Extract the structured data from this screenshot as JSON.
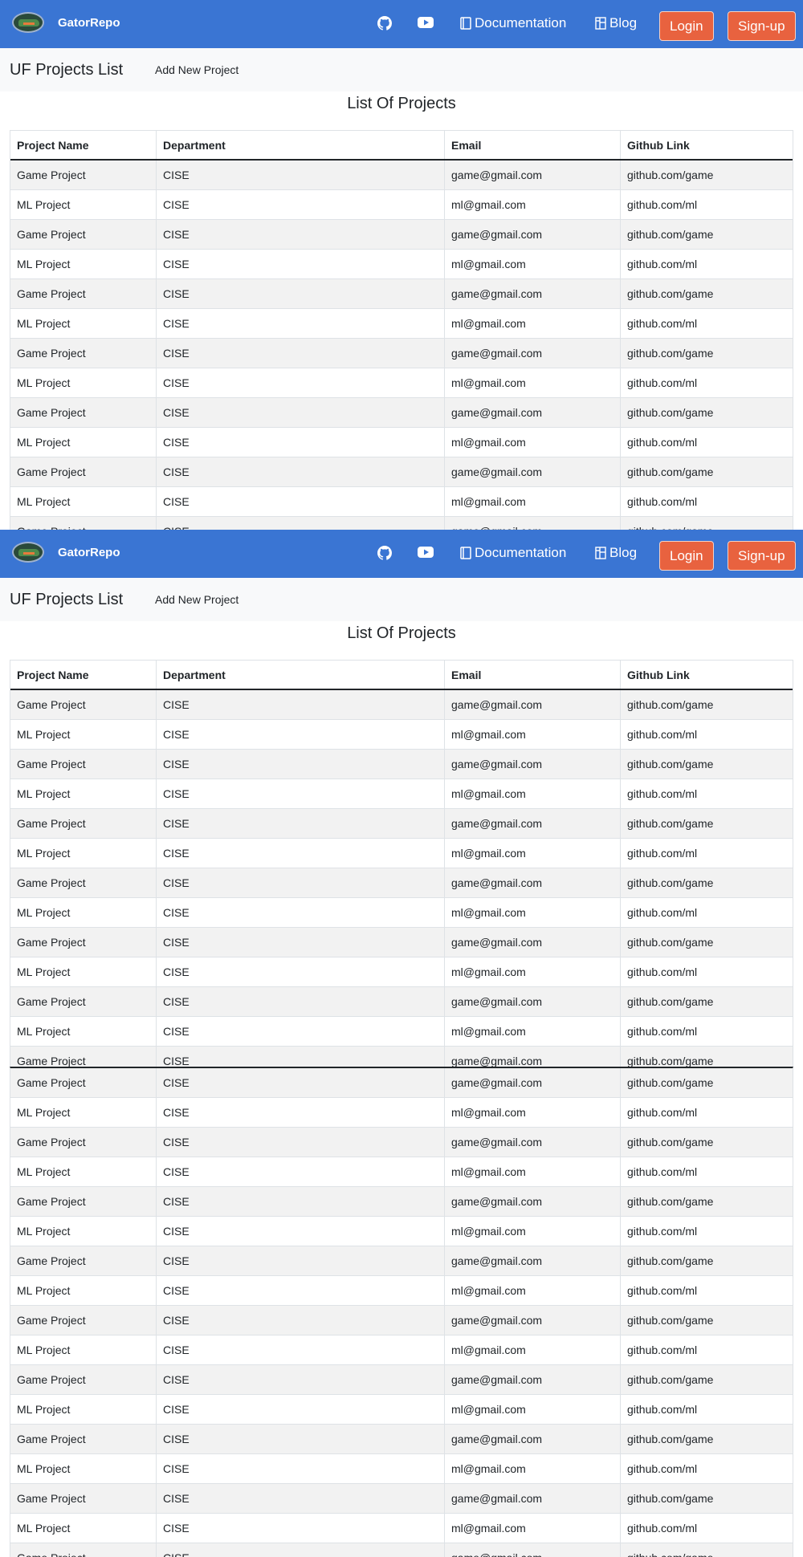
{
  "nav": {
    "brand": "GatorRepo",
    "documentation": "Documentation",
    "blog": "Blog",
    "login": "Login",
    "signup": "Sign-up",
    "icons": [
      "gator-logo-icon",
      "github-icon",
      "youtube-icon",
      "book-icon",
      "layout-icon"
    ]
  },
  "subbar": {
    "title": "UF Projects List",
    "add_project": "Add New Project"
  },
  "heading": "List Of Projects",
  "table": {
    "columns": [
      "Project Name",
      "Department",
      "Email",
      "Github Link"
    ],
    "rows": [
      [
        "Game Project",
        "CISE",
        "game@gmail.com",
        "github.com/game"
      ],
      [
        "ML Project",
        "CISE",
        "ml@gmail.com",
        "github.com/ml"
      ],
      [
        "Game Project",
        "CISE",
        "game@gmail.com",
        "github.com/game"
      ],
      [
        "ML Project",
        "CISE",
        "ml@gmail.com",
        "github.com/ml"
      ],
      [
        "Game Project",
        "CISE",
        "game@gmail.com",
        "github.com/game"
      ],
      [
        "ML Project",
        "CISE",
        "ml@gmail.com",
        "github.com/ml"
      ],
      [
        "Game Project",
        "CISE",
        "game@gmail.com",
        "github.com/game"
      ],
      [
        "ML Project",
        "CISE",
        "ml@gmail.com",
        "github.com/ml"
      ],
      [
        "Game Project",
        "CISE",
        "game@gmail.com",
        "github.com/game"
      ],
      [
        "ML Project",
        "CISE",
        "ml@gmail.com",
        "github.com/ml"
      ],
      [
        "Game Project",
        "CISE",
        "game@gmail.com",
        "github.com/game"
      ],
      [
        "ML Project",
        "CISE",
        "ml@gmail.com",
        "github.com/ml"
      ],
      [
        "Game Project",
        "CISE",
        "game@gmail.com",
        "github.com/game"
      ]
    ],
    "continued_rows": [
      [
        "Game Project",
        "CISE",
        "game@gmail.com",
        "github.com/game"
      ],
      [
        "ML Project",
        "CISE",
        "ml@gmail.com",
        "github.com/ml"
      ],
      [
        "Game Project",
        "CISE",
        "game@gmail.com",
        "github.com/game"
      ],
      [
        "ML Project",
        "CISE",
        "ml@gmail.com",
        "github.com/ml"
      ],
      [
        "Game Project",
        "CISE",
        "game@gmail.com",
        "github.com/game"
      ],
      [
        "ML Project",
        "CISE",
        "ml@gmail.com",
        "github.com/ml"
      ],
      [
        "Game Project",
        "CISE",
        "game@gmail.com",
        "github.com/game"
      ],
      [
        "ML Project",
        "CISE",
        "ml@gmail.com",
        "github.com/ml"
      ],
      [
        "Game Project",
        "CISE",
        "game@gmail.com",
        "github.com/game"
      ],
      [
        "ML Project",
        "CISE",
        "ml@gmail.com",
        "github.com/ml"
      ],
      [
        "Game Project",
        "CISE",
        "game@gmail.com",
        "github.com/game"
      ],
      [
        "ML Project",
        "CISE",
        "ml@gmail.com",
        "github.com/ml"
      ],
      [
        "Game Project",
        "CISE",
        "game@gmail.com",
        "github.com/game"
      ],
      [
        "ML Project",
        "CISE",
        "ml@gmail.com",
        "github.com/ml"
      ],
      [
        "Game Project",
        "CISE",
        "game@gmail.com",
        "github.com/game"
      ],
      [
        "ML Project",
        "CISE",
        "ml@gmail.com",
        "github.com/ml"
      ],
      [
        "Game Project",
        "CISE",
        "game@gmail.com",
        "github.com/game"
      ]
    ]
  },
  "colors": {
    "navbar": "#3a75d3",
    "button": "#e8623f",
    "stripe": "#f2f2f2",
    "subbar": "#f8f9fa"
  }
}
